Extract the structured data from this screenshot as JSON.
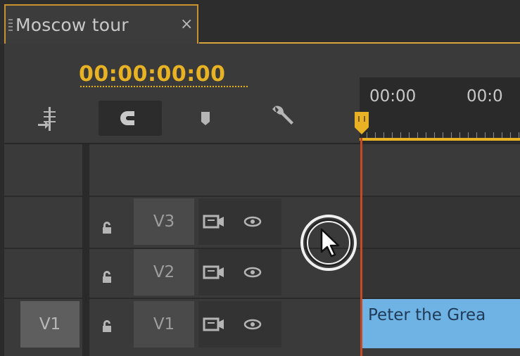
{
  "tab": {
    "title": "Moscow tour",
    "close_glyph": "×"
  },
  "timecode": "00:00:00:00",
  "ruler": {
    "labels": [
      "00:00",
      "00:0"
    ]
  },
  "toolbar": {
    "icons": [
      "insert-nest-icon",
      "snap-magnet-icon",
      "add-marker-icon",
      "wrench-settings-icon"
    ]
  },
  "source_patch": {
    "label": "V1"
  },
  "tracks": [
    {
      "name": "V3",
      "locked": false
    },
    {
      "name": "V2",
      "locked": false
    },
    {
      "name": "V1",
      "locked": false
    }
  ],
  "clip": {
    "label": "Peter the Grea"
  },
  "colors": {
    "accent": "#e9b224",
    "playhead": "#c74a26",
    "clip": "#6fb2e4"
  }
}
